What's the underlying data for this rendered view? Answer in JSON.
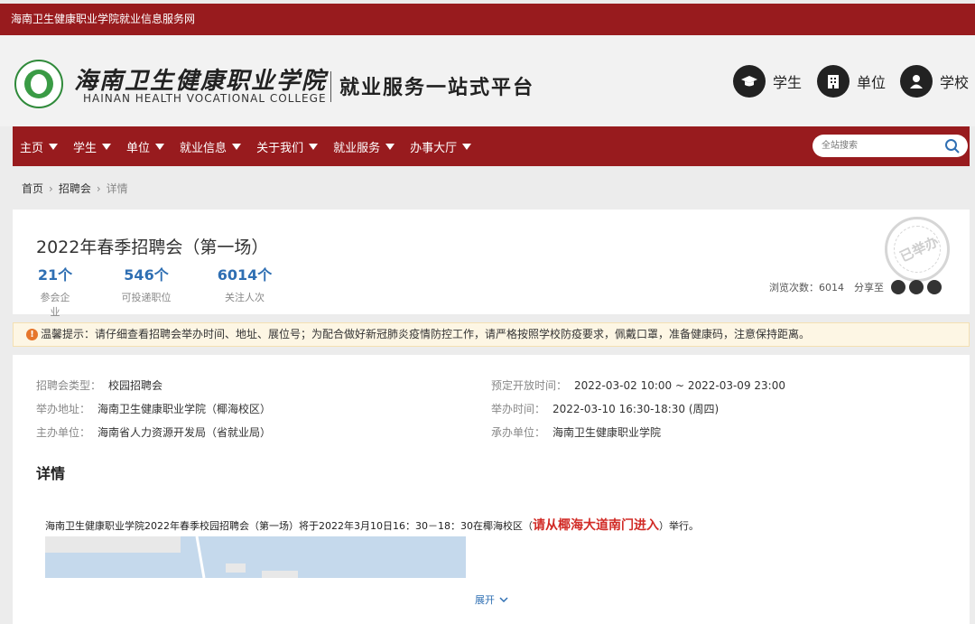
{
  "topbar": {
    "title": "海南卫生健康职业学院就业信息服务网"
  },
  "header": {
    "logo_cn": "海南卫生健康职业学院",
    "logo_en": "HAINAN HEALTH VOCATIONAL COLLEGE",
    "slogan": "就业服务一站式平台",
    "roles": [
      {
        "label": "学生",
        "icon": "graduation-cap-icon"
      },
      {
        "label": "单位",
        "icon": "building-icon"
      },
      {
        "label": "学校",
        "icon": "teacher-icon"
      }
    ]
  },
  "nav": {
    "items": [
      {
        "label": "主页"
      },
      {
        "label": "学生"
      },
      {
        "label": "单位"
      },
      {
        "label": "就业信息"
      },
      {
        "label": "关于我们"
      },
      {
        "label": "就业服务"
      },
      {
        "label": "办事大厅"
      }
    ],
    "search_placeholder": "全站搜索"
  },
  "breadcrumb": {
    "home": "首页",
    "section": "招聘会",
    "current": "详情"
  },
  "fair": {
    "title": "2022年春季招聘会（第一场）",
    "stats": [
      {
        "value": "21个",
        "label": "参会企业"
      },
      {
        "value": "546个",
        "label": "可投递职位"
      },
      {
        "value": "6014个",
        "label": "关注人次"
      }
    ],
    "stamp": "已举办",
    "views": "浏览次数：6014",
    "share_label": "分享至"
  },
  "notice": {
    "text": "温馨提示：请仔细查看招聘会举办时间、地址、展位号；为配合做好新冠肺炎疫情防控工作，请严格按照学校防疫要求，佩戴口罩，准备健康码，注意保持距离。"
  },
  "info": {
    "type_k": "招聘会类型：",
    "type_v": "校园招聘会",
    "addr_k": "举办地址：",
    "addr_v": "海南卫生健康职业学院（椰海校区）",
    "host_k": "主办单位：",
    "host_v": "海南省人力资源开发局（省就业局）",
    "open_k": "预定开放时间：",
    "open_v": "2022-03-02 10:00 ~ 2022-03-09 23:00",
    "time_k": "举办时间：",
    "time_v": "2022-03-10 16:30-18:30 (周四)",
    "org_k": "承办单位：",
    "org_v": "海南卫生健康职业学院"
  },
  "detail": {
    "heading": "详情",
    "text_before": "海南卫生健康职业学院2022年春季校园招聘会（第一场）将于2022年3月10日16：30－18：30在椰海校区（",
    "highlight": "请从椰海大道南门进入",
    "text_after": "）举行。",
    "expand": "展开"
  },
  "colors": {
    "brand": "#981b1e",
    "accent": "#2f6fb3",
    "highlight": "#d12b26"
  }
}
